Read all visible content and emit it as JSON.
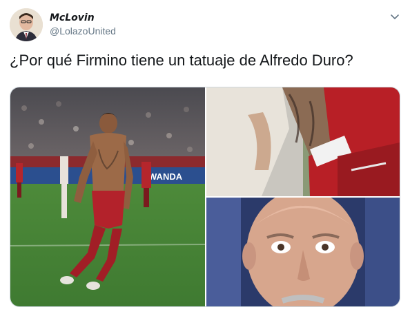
{
  "tweet": {
    "author": {
      "display_name": "McLovin",
      "handle": "@LolazoUnited"
    },
    "text": "¿Por qué Firmino tiene un tatuaje de Alfredo Duro?",
    "media": {
      "photo_count": 3,
      "photos": [
        {
          "label": "Football player celebrating shirtless on pitch"
        },
        {
          "label": "Close-up of tattooed arm with red sleeve"
        },
        {
          "label": "Close-up of bald man's face"
        }
      ],
      "stadium_ad_text": "WANDA"
    }
  }
}
